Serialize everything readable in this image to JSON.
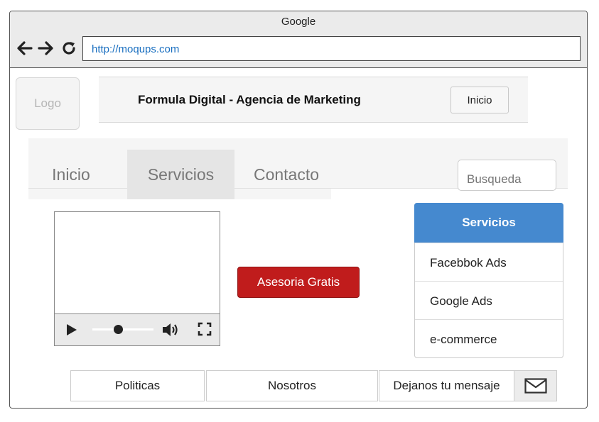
{
  "browser": {
    "title": "Google",
    "url": "http://moqups.com"
  },
  "logo": {
    "label": "Logo"
  },
  "header": {
    "title": "Formula Digital - Agencia de Marketing",
    "button_label": "Inicio"
  },
  "tabs": [
    {
      "label": "Inicio",
      "active": false
    },
    {
      "label": "Servicios",
      "active": true
    },
    {
      "label": "Contacto",
      "active": false
    }
  ],
  "search": {
    "placeholder": "Busqueda"
  },
  "video": {
    "progress": 0.42
  },
  "cta": {
    "label": "Asesoria Gratis"
  },
  "services": {
    "title": "Servicios",
    "items": [
      "Facebbok Ads",
      "Google Ads",
      "e-commerce"
    ]
  },
  "footer": {
    "items": [
      "Politicas",
      "Nosotros",
      "Dejanos tu mensaje"
    ],
    "icon": "mail-icon"
  },
  "colors": {
    "accent": "#4589cf",
    "cta": "#c01c1c",
    "url_text": "#1a6fc0"
  }
}
